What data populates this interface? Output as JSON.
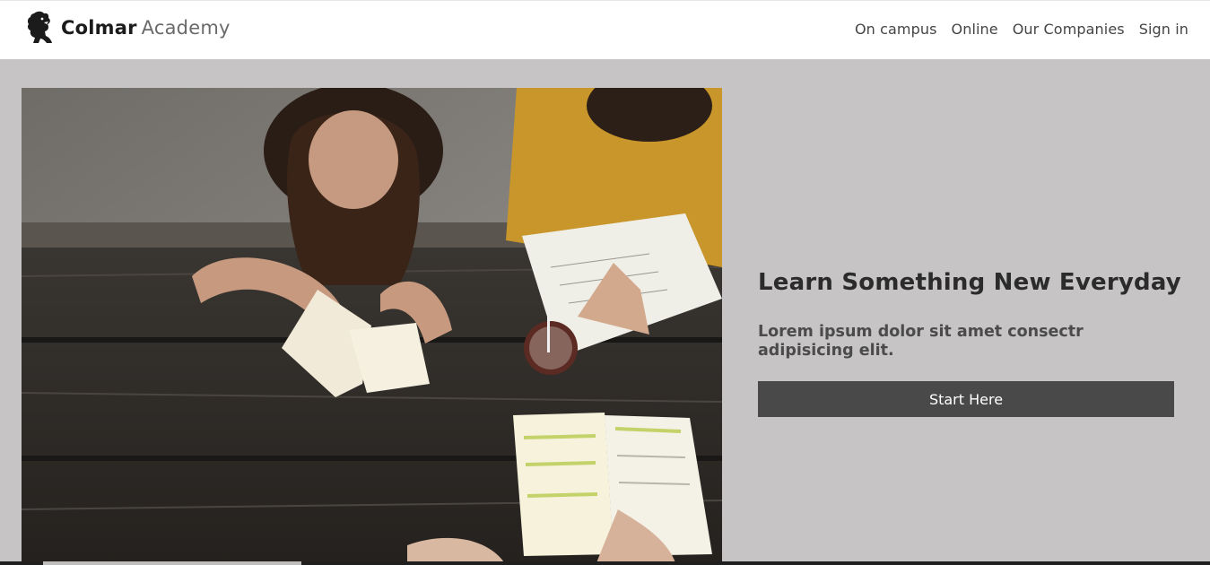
{
  "brand": {
    "name_bold": "Colmar",
    "name_light": "Academy",
    "logo_icon": "lion-icon"
  },
  "nav": {
    "items": [
      {
        "label": "On campus"
      },
      {
        "label": "Online"
      },
      {
        "label": "Our Companies"
      },
      {
        "label": "Sign in"
      }
    ]
  },
  "hero": {
    "headline": "Learn Something New Everyday",
    "subtext": "Lorem ipsum dolor sit amet consectr adipisicing elit.",
    "cta_label": "Start Here"
  },
  "colors": {
    "background": "#c6c4c4",
    "header": "#ffffff",
    "button": "#4a4949",
    "button_text": "#ffffff",
    "headline": "#2b2b2b"
  }
}
